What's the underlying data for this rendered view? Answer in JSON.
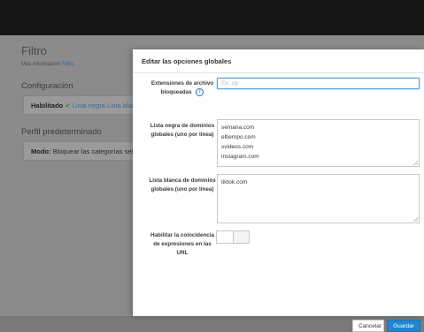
{
  "background": {
    "title": "Filtro",
    "info_prefix": "Más información",
    "info_link": "Filtro.",
    "config_heading": "Configuración",
    "enabled_label": "Habilitado",
    "enabled_check": "✔",
    "enabled_detail": "Lista negra Lista blanca",
    "profile_heading": "Perfil predeterminado",
    "mode_label": "Modo:",
    "mode_value": "Bloquear las categorías seleccionadas"
  },
  "modal": {
    "title": "Editar las opciones globales",
    "extensions": {
      "label": "Extensiones de archivo bloqueadas",
      "placeholder": "Ex: zip",
      "value": ""
    },
    "blacklist": {
      "label": "Lista negra de dominios globales (uno por línea)",
      "lines": [
        "semana.com",
        "eltiempo.com",
        "xvideos.com",
        "instagram.com"
      ]
    },
    "whitelist": {
      "label": "Lista blanca de dominios globales (uno por línea)",
      "lines": [
        "tiktok.com"
      ]
    },
    "regex": {
      "label": "Habilitar la coincidencia de expresiones en las URL",
      "enabled": false
    },
    "cancel_label": "Cancelar",
    "save_label": "Guardar"
  },
  "colors": {
    "primary": "#1f87d4",
    "overlay_bg": "#8b8b8b",
    "topbar": "#161616"
  }
}
